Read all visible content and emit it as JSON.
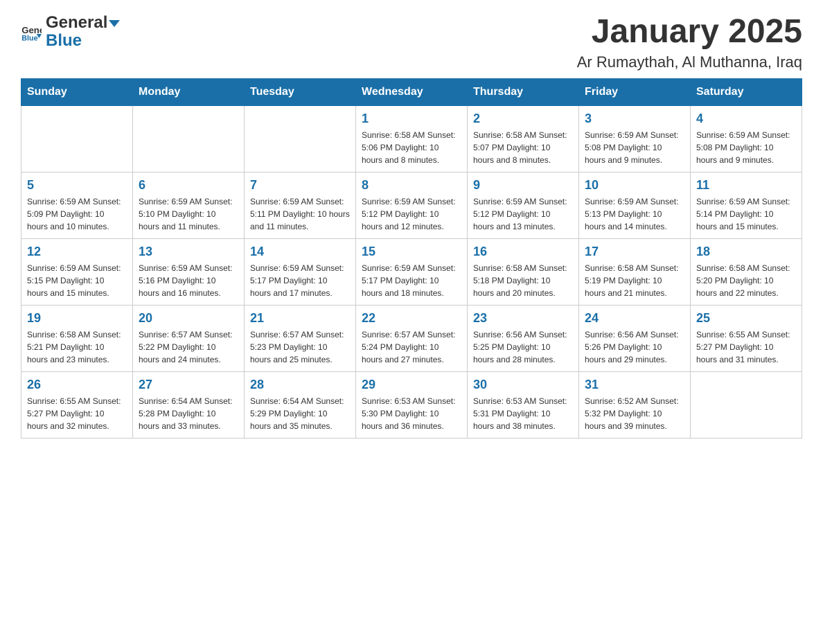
{
  "header": {
    "logo_general": "General",
    "logo_blue": "Blue",
    "title": "January 2025",
    "subtitle": "Ar Rumaythah, Al Muthanna, Iraq"
  },
  "days_of_week": [
    "Sunday",
    "Monday",
    "Tuesday",
    "Wednesday",
    "Thursday",
    "Friday",
    "Saturday"
  ],
  "weeks": [
    [
      {
        "day": "",
        "info": ""
      },
      {
        "day": "",
        "info": ""
      },
      {
        "day": "",
        "info": ""
      },
      {
        "day": "1",
        "info": "Sunrise: 6:58 AM\nSunset: 5:06 PM\nDaylight: 10 hours and 8 minutes."
      },
      {
        "day": "2",
        "info": "Sunrise: 6:58 AM\nSunset: 5:07 PM\nDaylight: 10 hours and 8 minutes."
      },
      {
        "day": "3",
        "info": "Sunrise: 6:59 AM\nSunset: 5:08 PM\nDaylight: 10 hours and 9 minutes."
      },
      {
        "day": "4",
        "info": "Sunrise: 6:59 AM\nSunset: 5:08 PM\nDaylight: 10 hours and 9 minutes."
      }
    ],
    [
      {
        "day": "5",
        "info": "Sunrise: 6:59 AM\nSunset: 5:09 PM\nDaylight: 10 hours and 10 minutes."
      },
      {
        "day": "6",
        "info": "Sunrise: 6:59 AM\nSunset: 5:10 PM\nDaylight: 10 hours and 11 minutes."
      },
      {
        "day": "7",
        "info": "Sunrise: 6:59 AM\nSunset: 5:11 PM\nDaylight: 10 hours and 11 minutes."
      },
      {
        "day": "8",
        "info": "Sunrise: 6:59 AM\nSunset: 5:12 PM\nDaylight: 10 hours and 12 minutes."
      },
      {
        "day": "9",
        "info": "Sunrise: 6:59 AM\nSunset: 5:12 PM\nDaylight: 10 hours and 13 minutes."
      },
      {
        "day": "10",
        "info": "Sunrise: 6:59 AM\nSunset: 5:13 PM\nDaylight: 10 hours and 14 minutes."
      },
      {
        "day": "11",
        "info": "Sunrise: 6:59 AM\nSunset: 5:14 PM\nDaylight: 10 hours and 15 minutes."
      }
    ],
    [
      {
        "day": "12",
        "info": "Sunrise: 6:59 AM\nSunset: 5:15 PM\nDaylight: 10 hours and 15 minutes."
      },
      {
        "day": "13",
        "info": "Sunrise: 6:59 AM\nSunset: 5:16 PM\nDaylight: 10 hours and 16 minutes."
      },
      {
        "day": "14",
        "info": "Sunrise: 6:59 AM\nSunset: 5:17 PM\nDaylight: 10 hours and 17 minutes."
      },
      {
        "day": "15",
        "info": "Sunrise: 6:59 AM\nSunset: 5:17 PM\nDaylight: 10 hours and 18 minutes."
      },
      {
        "day": "16",
        "info": "Sunrise: 6:58 AM\nSunset: 5:18 PM\nDaylight: 10 hours and 20 minutes."
      },
      {
        "day": "17",
        "info": "Sunrise: 6:58 AM\nSunset: 5:19 PM\nDaylight: 10 hours and 21 minutes."
      },
      {
        "day": "18",
        "info": "Sunrise: 6:58 AM\nSunset: 5:20 PM\nDaylight: 10 hours and 22 minutes."
      }
    ],
    [
      {
        "day": "19",
        "info": "Sunrise: 6:58 AM\nSunset: 5:21 PM\nDaylight: 10 hours and 23 minutes."
      },
      {
        "day": "20",
        "info": "Sunrise: 6:57 AM\nSunset: 5:22 PM\nDaylight: 10 hours and 24 minutes."
      },
      {
        "day": "21",
        "info": "Sunrise: 6:57 AM\nSunset: 5:23 PM\nDaylight: 10 hours and 25 minutes."
      },
      {
        "day": "22",
        "info": "Sunrise: 6:57 AM\nSunset: 5:24 PM\nDaylight: 10 hours and 27 minutes."
      },
      {
        "day": "23",
        "info": "Sunrise: 6:56 AM\nSunset: 5:25 PM\nDaylight: 10 hours and 28 minutes."
      },
      {
        "day": "24",
        "info": "Sunrise: 6:56 AM\nSunset: 5:26 PM\nDaylight: 10 hours and 29 minutes."
      },
      {
        "day": "25",
        "info": "Sunrise: 6:55 AM\nSunset: 5:27 PM\nDaylight: 10 hours and 31 minutes."
      }
    ],
    [
      {
        "day": "26",
        "info": "Sunrise: 6:55 AM\nSunset: 5:27 PM\nDaylight: 10 hours and 32 minutes."
      },
      {
        "day": "27",
        "info": "Sunrise: 6:54 AM\nSunset: 5:28 PM\nDaylight: 10 hours and 33 minutes."
      },
      {
        "day": "28",
        "info": "Sunrise: 6:54 AM\nSunset: 5:29 PM\nDaylight: 10 hours and 35 minutes."
      },
      {
        "day": "29",
        "info": "Sunrise: 6:53 AM\nSunset: 5:30 PM\nDaylight: 10 hours and 36 minutes."
      },
      {
        "day": "30",
        "info": "Sunrise: 6:53 AM\nSunset: 5:31 PM\nDaylight: 10 hours and 38 minutes."
      },
      {
        "day": "31",
        "info": "Sunrise: 6:52 AM\nSunset: 5:32 PM\nDaylight: 10 hours and 39 minutes."
      },
      {
        "day": "",
        "info": ""
      }
    ]
  ]
}
